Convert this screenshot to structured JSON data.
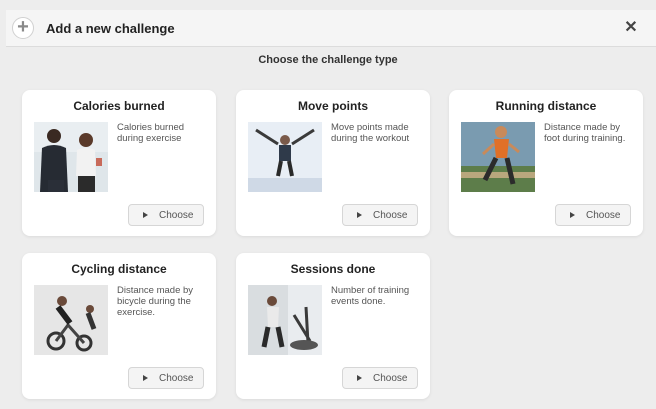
{
  "dialog": {
    "title": "Add a new challenge",
    "subtitle": "Choose the challenge type",
    "icons": {
      "add": "plus-icon",
      "close": "close-icon"
    }
  },
  "cards": [
    {
      "title": "Calories burned",
      "description": "Calories burned during exercise",
      "button_label": "Choose",
      "photo": "two people exercising"
    },
    {
      "title": "Move points",
      "description": "Move points made during the workout",
      "button_label": "Choose",
      "photo": "person jumping"
    },
    {
      "title": "Running distance",
      "description": "Distance made by foot during training.",
      "button_label": "Choose",
      "photo": "runner on track"
    },
    {
      "title": "Cycling distance",
      "description": "Distance made by bicycle during the exercise.",
      "button_label": "Choose",
      "photo": "indoor cycling class"
    },
    {
      "title": "Sessions done",
      "description": "Number of training events done.",
      "button_label": "Choose",
      "photo": "gym cardio machines"
    }
  ]
}
